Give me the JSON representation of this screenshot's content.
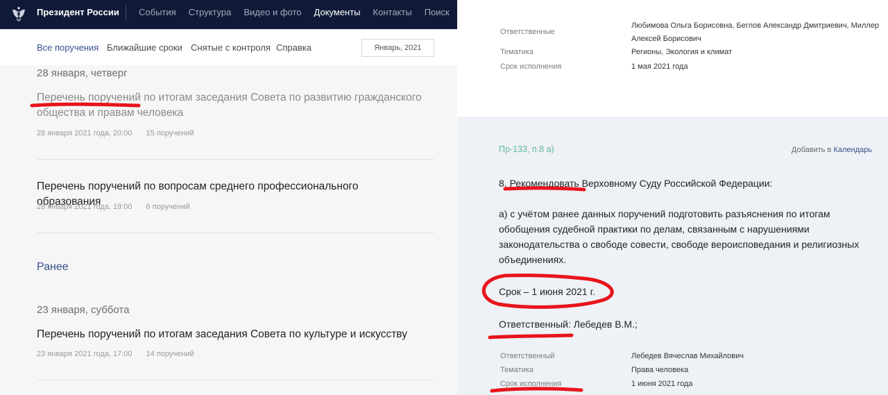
{
  "header": {
    "site_title": "Президент России",
    "nav": [
      "События",
      "Структура",
      "Видео и фото",
      "Документы",
      "Контакты",
      "Поиск"
    ],
    "active_nav": "Документы"
  },
  "subnav": {
    "tabs": [
      "Все поручения",
      "Ближайшие сроки",
      "Снятые с контроля",
      "Справка"
    ],
    "month": "Январь, 2021"
  },
  "list": {
    "date1": "28 января, четверг",
    "items": [
      {
        "title": "Перечень поручений по итогам заседания Совета по развитию гражданского общества и правам человека",
        "date": "28 января 2021 года, 20:00",
        "count": "15 поручений"
      },
      {
        "title": "Перечень поручений по вопросам среднего профессионального образования",
        "date": "28 января 2021 года, 19:00",
        "count": "6 поручений"
      },
      {
        "title": "Перечень поручений по итогам заседания Совета по культуре и искусству",
        "date": "23 января 2021 года, 17:00",
        "count": "14 поручений"
      }
    ],
    "earlier": "Ранее",
    "date2": "23 января, суббота"
  },
  "details_top": {
    "labels": [
      "Ответственные",
      "Тематика",
      "Срок исполнения"
    ],
    "responsible": "Любимова Ольга Борисовна, Беглов Александр Дмитриевич, Миллер Алексей Борисович",
    "topic": "Регионы, Экология и климат",
    "deadline": "1 мая 2021 года"
  },
  "order": {
    "id": "Пр-133, п.8 а)",
    "add_prefix": "Добавить в ",
    "add_link": "Календарь",
    "p1": "8. Рекомендовать Верховному Суду Российской Федерации:",
    "p2": "а) с учётом ранее данных поручений подготовить разъяснения по итогам обобщения судебной практики по делам, связанным с нарушениями законодательства о свободе совести, свободе вероисповедания и религиозных объединениях.",
    "p3": "Срок – 1 июня 2021 г.",
    "p4": "Ответственный: Лебедев В.М.;",
    "labels": [
      "Ответственный",
      "Тематика",
      "Срок исполнения"
    ],
    "responsible": "Лебедев Вячеслав Михайлович",
    "topic": "Права человека",
    "deadline": "1 июня 2021 года"
  },
  "colors": {
    "header_bg": "#0f1a38",
    "link": "#34508c",
    "order_id": "#5fb8a0",
    "annotation": "#e8141b"
  }
}
